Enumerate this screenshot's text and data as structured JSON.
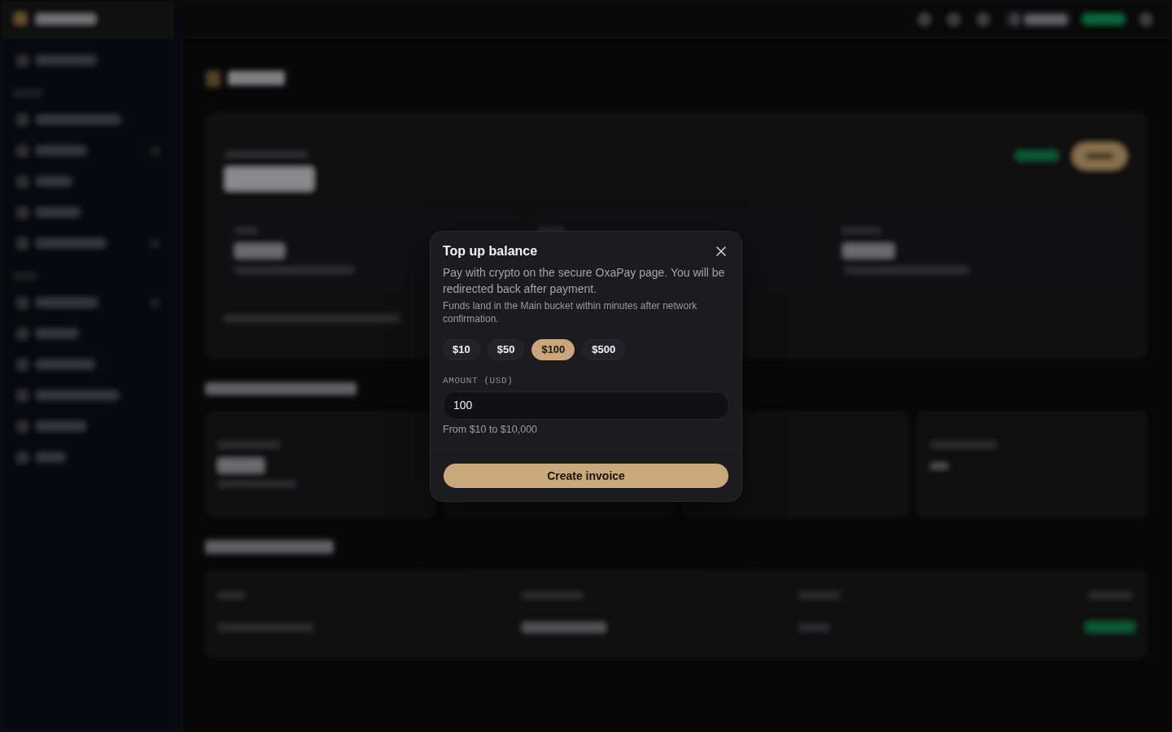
{
  "dialog": {
    "title": "Top up balance",
    "description": "Pay with crypto on the secure OxaPay page. You will be redirected back after payment.",
    "note": "Funds land in the Main bucket within minutes after network confirmation.",
    "presets": [
      {
        "label": "$10",
        "selected": false
      },
      {
        "label": "$50",
        "selected": false
      },
      {
        "label": "$100",
        "selected": true
      },
      {
        "label": "$500",
        "selected": false
      }
    ],
    "amount_field": {
      "label": "AMOUNT (USD)",
      "value": "100",
      "hint": "From $10 to $10,000"
    },
    "submit_button": "Create invoice"
  }
}
